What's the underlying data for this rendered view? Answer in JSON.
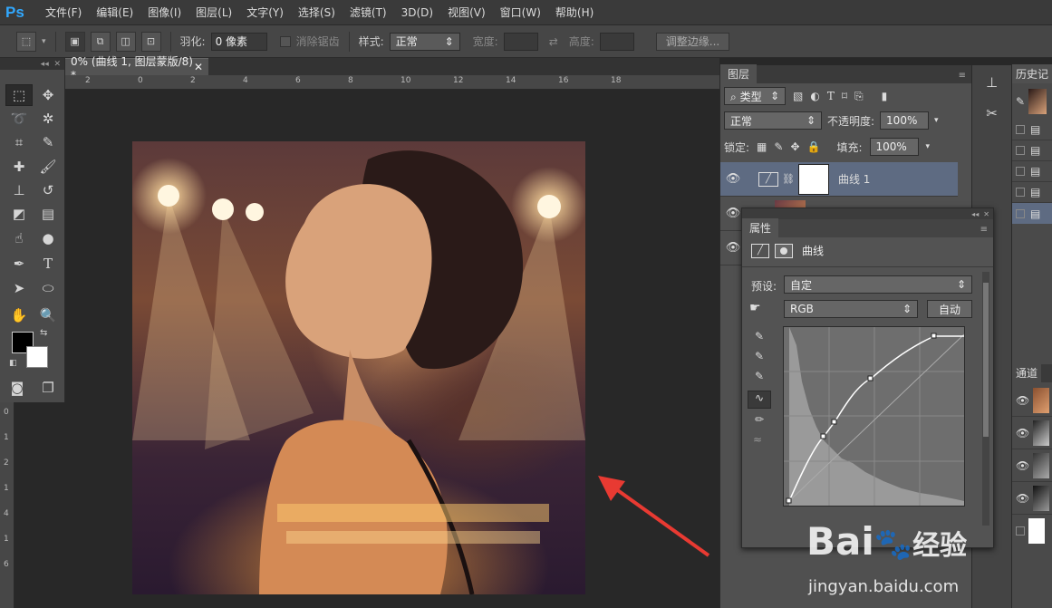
{
  "app": {
    "logo": "Ps"
  },
  "menu": [
    "文件(F)",
    "编辑(E)",
    "图像(I)",
    "图层(L)",
    "文字(Y)",
    "选择(S)",
    "滤镜(T)",
    "3D(D)",
    "视图(V)",
    "窗口(W)",
    "帮助(H)"
  ],
  "options": {
    "feather_label": "羽化:",
    "feather_value": "0 像素",
    "antialias_label": "消除锯齿",
    "style_label": "样式:",
    "style_value": "正常",
    "width_label": "宽度:",
    "height_label": "高度:",
    "refine_edge": "调整边缘..."
  },
  "document": {
    "tab_title": "0% (曲线 1, 图层蒙版/8) *"
  },
  "ruler": {
    "h_ticks": [
      "2",
      "0",
      "2",
      "4",
      "6",
      "8",
      "10",
      "12",
      "14",
      "16",
      "18"
    ],
    "v_ticks": [
      "0",
      "1",
      "2",
      "1",
      "4",
      "1",
      "6"
    ]
  },
  "layers_panel": {
    "tab": "图层",
    "filter_kind": "类型",
    "blend_mode": "正常",
    "opacity_label": "不透明度:",
    "opacity_value": "100%",
    "lock_label": "锁定:",
    "fill_label": "填充:",
    "fill_value": "100%",
    "layers": [
      {
        "name": "曲线 1",
        "selected": true
      }
    ]
  },
  "history_panel": {
    "tab": "历史记"
  },
  "channels_panel": {
    "tab": "通道"
  },
  "properties": {
    "tab": "属性",
    "type_label": "曲线",
    "preset_label": "预设:",
    "preset_value": "自定",
    "channel_value": "RGB",
    "auto_button": "自动"
  },
  "colors": {
    "accent": "#31a8ff",
    "selected_layer": "#5e6b82",
    "annotation_arrow": "#e83a32"
  },
  "watermark": {
    "brand": "Bai",
    "brand2": "经验",
    "url": "jingyan.baidu.com"
  }
}
